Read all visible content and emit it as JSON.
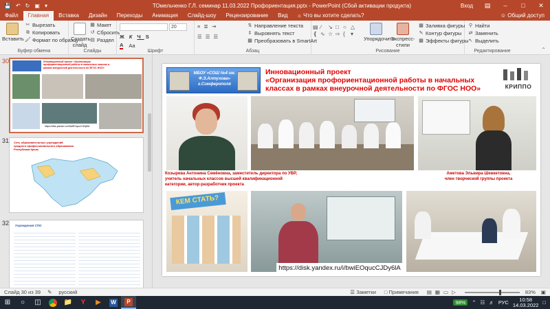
{
  "window": {
    "title": "ТОмельченко Г.Л. семинар 11.03.2022 Профориентация.pptx  -  PowerPoint (Сбой активации продукта)",
    "login": "Вход"
  },
  "ribbon": {
    "tabs": [
      "Файл",
      "Главная",
      "Вставка",
      "Дизайн",
      "Переходы",
      "Анимация",
      "Слайд-шоу",
      "Рецензирование",
      "Вид"
    ],
    "active_tab": "Главная",
    "tell_me": "Что вы хотите сделать?",
    "share": "Общий доступ",
    "clipboard": {
      "paste": "Вставить",
      "cut": "Вырезать",
      "copy": "Копировать",
      "format_painter": "Формат по образцу",
      "label": "Буфер обмена"
    },
    "slides": {
      "new_slide": "Создать слайд",
      "layout": "Макет",
      "reset": "Сбросить",
      "section": "Раздел",
      "label": "Слайды"
    },
    "font": {
      "size": "20",
      "label": "Шрифт"
    },
    "paragraph": {
      "text_direction": "Направление текста",
      "align_text": "Выровнять текст",
      "smartart": "Преобразовать в SmartArt",
      "label": "Абзац"
    },
    "drawing": {
      "arrange": "Упорядочить",
      "quick_styles": "Экспресс-стили",
      "shape_fill": "Заливка фигуры",
      "shape_outline": "Контур фигуры",
      "shape_effects": "Эффекты фигуры",
      "label": "Рисование"
    },
    "editing": {
      "find": "Найти",
      "replace": "Заменить",
      "select": "Выделить",
      "label": "Редактирование"
    }
  },
  "thumbnails": [
    {
      "number": "30",
      "title": "Инновационный проект «Организация профориентационной работы в начальных классах в рамках внеурочной деятельности по ФГОС НОО»",
      "link": "https://disk.yandex.ru/i/bwiEOqucCJDy6lA"
    },
    {
      "number": "31",
      "title": "Сеть образовательных учреждений среднего профессионального образования Республики Крым"
    },
    {
      "number": "32",
      "title": "Учреждения СПО"
    }
  ],
  "slide": {
    "school_banner": "МБОУ «СОШ №4 им. Ф.Э.Алтухова» г.Симферополя",
    "title_line1": "Инновационный проект",
    "title_line2": "«Организация профориентационной работы в начальных",
    "title_line3": "классах в рамках внеурочной деятельности по ФГОС НОО»",
    "logo": "КРИППО",
    "caption_left": "Козырева Антонина Семёновна, заместитель директора по УВР, учитель начальных классов высшей квалификационной категории, автор-разработчик проекта",
    "caption_right_line1": "Аметова Эльвира Шевкетовна,",
    "caption_right_line2": "член творческой группы проекта",
    "poster_text": "КЕМ СТАТЬ?",
    "link": "https://disk.yandex.ru/i/bwiEOqucCJDy6lA"
  },
  "status": {
    "slide_info": "Слайд 30 из 39",
    "language": "русский",
    "notes": "Заметки",
    "comments": "Примечания",
    "zoom": "83%"
  },
  "taskbar": {
    "battery": "98%",
    "input_lang": "РУС",
    "time": "10:58",
    "date": "14.03.2022"
  },
  "colors": {
    "accent": "#b7472a",
    "slide_title": "#e00000",
    "caption": "#cc0000",
    "banner_blue": "#1f5fb4"
  }
}
